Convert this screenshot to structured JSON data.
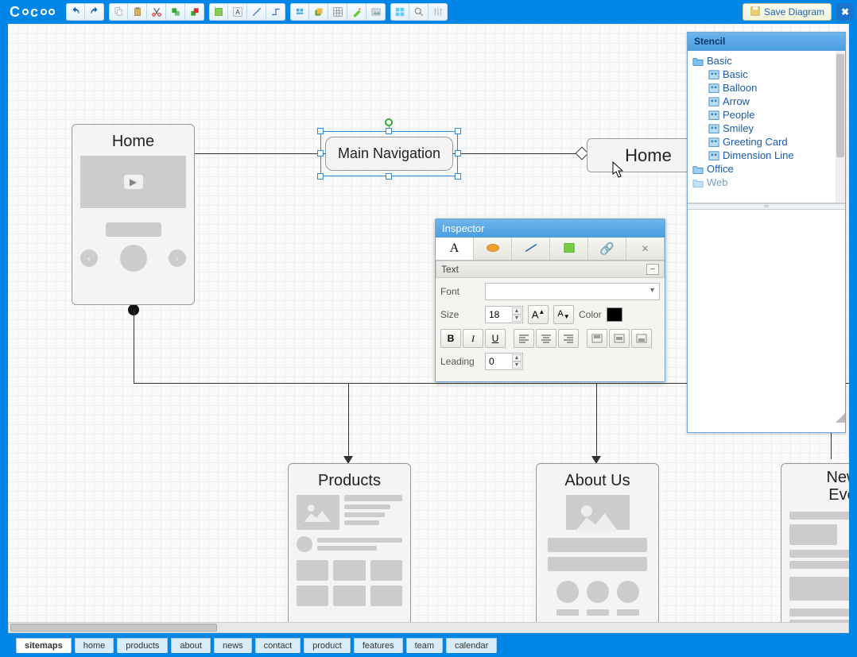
{
  "brand": "Cacoo",
  "toolbar": {
    "save_label": "Save Diagram"
  },
  "stencil": {
    "title": "Stencil",
    "folders": [
      {
        "label": "Basic",
        "open": true,
        "children": [
          "Basic",
          "Balloon",
          "Arrow",
          "People",
          "Smiley",
          "Greeting Card",
          "Dimension Line"
        ]
      },
      {
        "label": "Office",
        "open": false
      },
      {
        "label": "Web",
        "open": false
      }
    ]
  },
  "inspector": {
    "title": "Inspector",
    "section_text": "Text",
    "font_label": "Font",
    "size_label": "Size",
    "size_value": "18",
    "color_label": "Color",
    "color_value": "#000000",
    "leading_label": "Leading",
    "leading_value": "0"
  },
  "nodes": {
    "home1_title": "Home",
    "nav_title": "Main Navigation",
    "home2_title": "Home",
    "products_title": "Products",
    "about_title": "About Us",
    "news_title_l1": "New",
    "news_title_l2": "Eve"
  },
  "sheets": [
    "sitemaps",
    "home",
    "products",
    "about",
    "news",
    "contact",
    "product",
    "features",
    "team",
    "calendar"
  ],
  "active_sheet": "sitemaps"
}
